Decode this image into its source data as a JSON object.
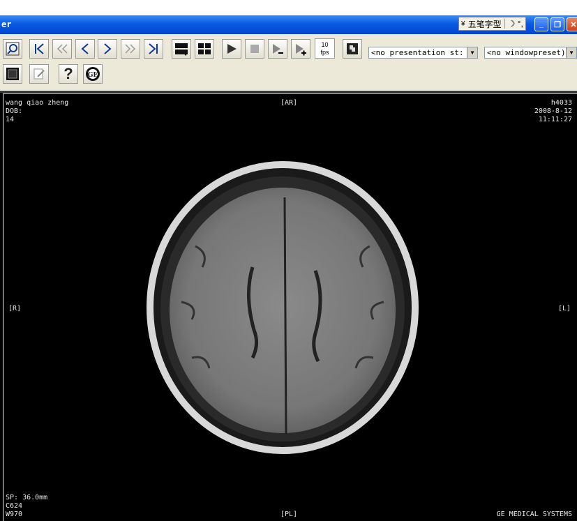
{
  "window": {
    "title": "er",
    "ime_label": "五笔字型",
    "ime_extra": "☽ °,",
    "buttons": {
      "minimize": "_",
      "restore": "❐",
      "close": "✕"
    }
  },
  "toolbar": {
    "row1_icons": [
      "magnifier-icon",
      "first-frame-icon",
      "rewind-icon",
      "previous-frame-icon",
      "next-frame-icon",
      "fast-forward-icon",
      "last-frame-icon",
      "layout-single-icon",
      "layout-grid-icon",
      "play-icon",
      "stop-icon",
      "speed-down-icon",
      "speed-up-icon"
    ],
    "fps_value": "10",
    "fps_unit": "fps",
    "presentation_state": "<no presentation st:",
    "window_preset": "<no windowpreset)"
  },
  "overlay": {
    "patient_name": "wang qiao zheng",
    "dob": "DOB:",
    "age": "14",
    "top_orient": "[AR]",
    "bottom_orient": "[PL]",
    "left_orient": "[R]",
    "right_orient": "[L]",
    "study_id": "h4033",
    "date": "2008-8-12",
    "time": "11:11:27",
    "sp": "SP: 36.0mm",
    "center": "C624",
    "width": "W970",
    "manufacturer": "GE MEDICAL SYSTEMS"
  }
}
